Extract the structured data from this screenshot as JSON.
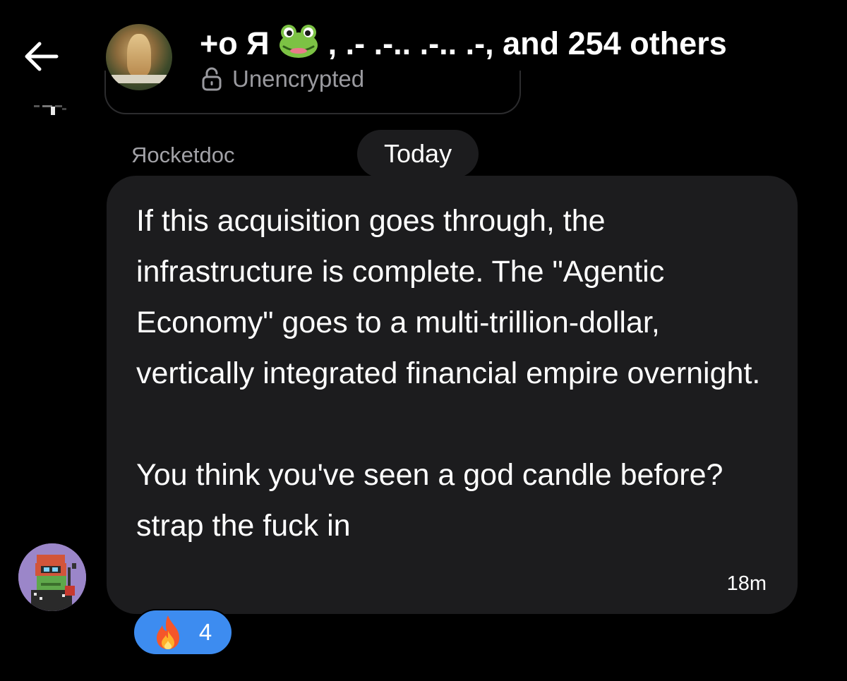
{
  "header": {
    "back_icon": "arrow-left-icon",
    "avatar_icon": "group-avatar",
    "title_prefix": "+o Я",
    "title_emoji": "frog-emoji",
    "title_suffix": ", .- .-.. .-.. .-, and 254 others",
    "encryption_icon": "lock-open-icon",
    "encryption_status": "Unencrypted"
  },
  "conversation": {
    "date_separator": "Today",
    "message": {
      "sender": "Яocketdoc",
      "paragraphs": [
        "If this acquisition goes through, the infrastructure is complete. The \"Agentic Economy\" goes to a multi-trillion-dollar, vertically integrated financial empire overnight.",
        "You think you've seen a god candle before? strap the fuck in"
      ],
      "time": "18m",
      "reaction": {
        "emoji_icon": "fire-emoji",
        "count": "4"
      }
    }
  },
  "colors": {
    "background": "#000000",
    "bubble": "#1c1c1e",
    "muted_text": "#9a9a9f",
    "reaction_blue": "#3d8cf0"
  }
}
